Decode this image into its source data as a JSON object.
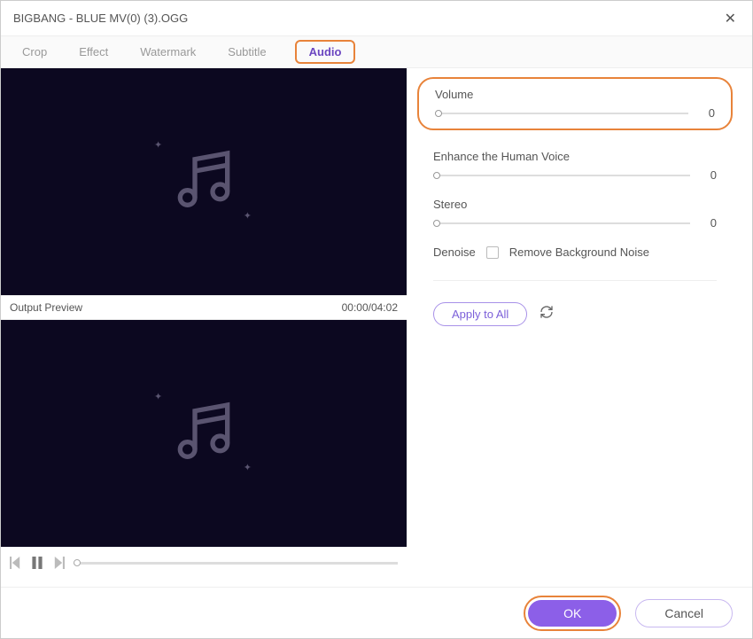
{
  "title": "BIGBANG - BLUE MV(0) (3).OGG",
  "tabs": {
    "crop": "Crop",
    "effect": "Effect",
    "watermark": "Watermark",
    "subtitle": "Subtitle",
    "audio": "Audio"
  },
  "preview": {
    "label": "Output Preview",
    "time": "00:00/04:02"
  },
  "controls": {
    "volume": {
      "label": "Volume",
      "value": "0"
    },
    "enhance": {
      "label": "Enhance the Human Voice",
      "value": "0"
    },
    "stereo": {
      "label": "Stereo",
      "value": "0"
    },
    "denoise": {
      "label": "Denoise",
      "checkbox_label": "Remove Background Noise"
    }
  },
  "apply_all": "Apply to All",
  "footer": {
    "ok": "OK",
    "cancel": "Cancel"
  }
}
